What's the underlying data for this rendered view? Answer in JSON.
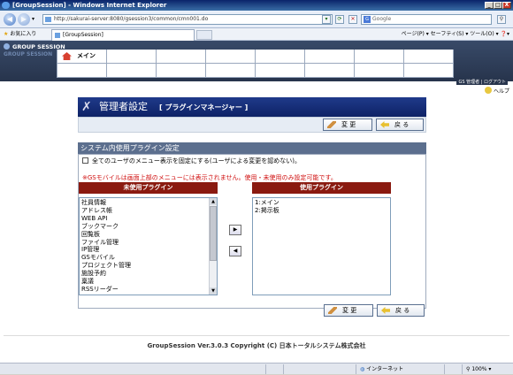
{
  "window": {
    "title": "[GroupSession] - Windows Internet Explorer",
    "controls": [
      "_",
      "□",
      "X"
    ]
  },
  "address_bar": {
    "url": "http://sakurai-server:8080/gsession3/common/cmn001.do",
    "search_placeholder": "Google"
  },
  "favorites_bar": {
    "favorites_label": "お気に入り",
    "tab_label": "[GroupSession]",
    "commands": "ページ(P) ▾  セーフティ(S) ▾  ツール(O) ▾  ❓▾"
  },
  "gs_header": {
    "logo_text": "GROUP SESSION",
    "logo_sub": "GROUP SESSION",
    "menu_main_label": "メイン",
    "user_info": "GS 管理者 | ログアウト",
    "help_label": "ヘルプ"
  },
  "admin": {
    "title": "管理者設定",
    "subtitle": "[ プラグインマネージャー ]",
    "change_label": "変 更",
    "back_label": "戻 る"
  },
  "plugin_settings": {
    "section_title": "システム内使用プラグイン設定",
    "checkbox_label": "全てのユーザのメニュー表示を固定にする(ユーザによる変更を認めない)。",
    "note": "※GSモバイルは画面上部のメニューには表示されません。使用・未使用のみ設定可能です。",
    "unused_header": "未使用プラグイン",
    "used_header": "使用プラグイン",
    "unused_plugins": [
      "社員情報",
      "アドレス帳",
      "WEB API",
      "ブックマーク",
      "回覧板",
      "ファイル管理",
      "IP管理",
      "GSモバイル",
      "プロジェクト管理",
      "施設予約",
      "稟議",
      "RSSリーダー"
    ],
    "used_plugins": [
      "1:メイン",
      "2:掲示板"
    ],
    "move_right_label": "▶",
    "move_left_label": "◀"
  },
  "footer": {
    "copyright": "GroupSession Ver.3.0.3 Copyright (C) 日本トータルシステム株式会社"
  },
  "status_bar": {
    "zone": "インターネット",
    "zoom": "100%"
  }
}
